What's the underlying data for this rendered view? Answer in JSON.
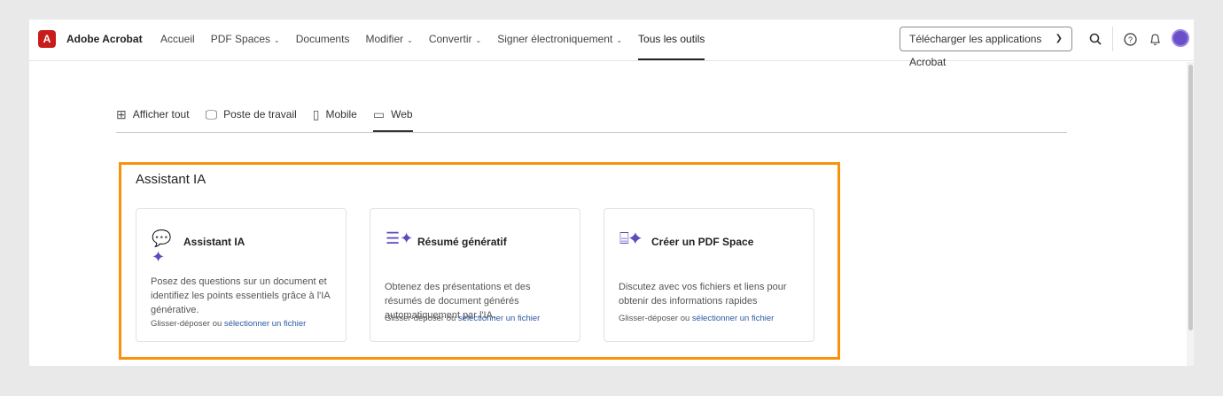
{
  "header": {
    "brand": "Adobe Acrobat",
    "logo": "A",
    "nav": [
      {
        "label": "Accueil",
        "dropdown": false
      },
      {
        "label": "PDF Spaces",
        "dropdown": true
      },
      {
        "label": "Documents",
        "dropdown": false
      },
      {
        "label": "Modifier",
        "dropdown": true
      },
      {
        "label": "Convertir",
        "dropdown": true
      },
      {
        "label": "Signer électroniquement",
        "dropdown": true
      },
      {
        "label": "Tous les outils",
        "dropdown": false,
        "active": true
      }
    ],
    "download": "Télécharger les applications Acrobat"
  },
  "tabs": [
    {
      "label": "Afficher tout",
      "icon": "grid-icon"
    },
    {
      "label": "Poste de travail",
      "icon": "desktop-icon"
    },
    {
      "label": "Mobile",
      "icon": "mobile-icon"
    },
    {
      "label": "Web",
      "icon": "browser-icon",
      "active": true
    }
  ],
  "section": {
    "title": "Assistant IA",
    "highlight": "#f7920a",
    "cards": [
      {
        "title": "Assistant IA",
        "desc": "Posez des questions sur un document et identifiez les points essentiels grâce à l'IA générative.",
        "drop": "Glisser-déposer ou ",
        "link": "sélectionner un fichier"
      },
      {
        "title": "Résumé génératif",
        "desc": "Obtenez des présentations et des résumés de document générés automatiquement par l'IA.",
        "drop": "Glisser-déposer ou ",
        "link": "sélectionner un fichier"
      },
      {
        "title": "Créer un PDF Space",
        "desc": "Discutez avec vos fichiers et liens pour obtenir des informations rapides",
        "drop": "Glisser-déposer ou ",
        "link": "sélectionner un fichier"
      }
    ]
  }
}
